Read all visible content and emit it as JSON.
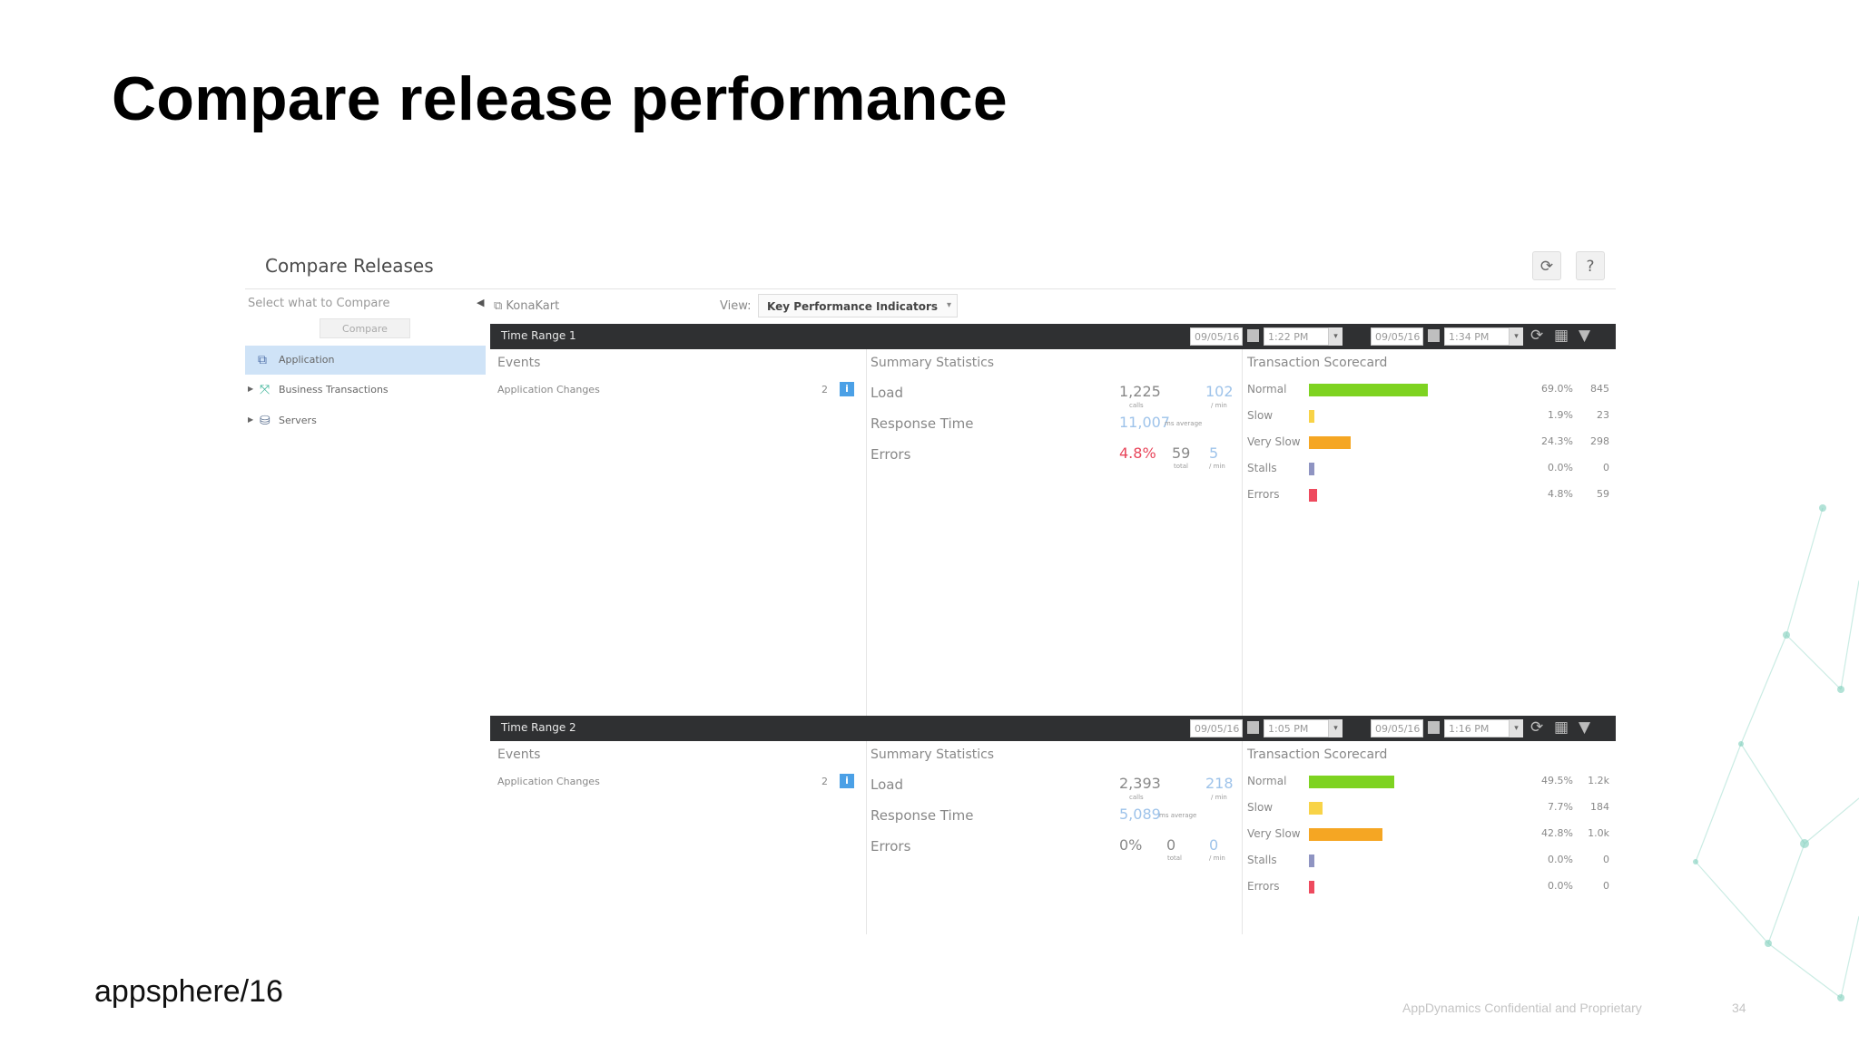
{
  "slide": {
    "title": "Compare release performance",
    "footer_logo": "appsphere/16",
    "confidential": "AppDynamics Confidential and Proprietary",
    "page_number": "34"
  },
  "app": {
    "title": "Compare Releases",
    "refresh_icon": "refresh-icon",
    "help_label": "?"
  },
  "sidebar": {
    "select_label": "Select what to Compare",
    "compare_button": "Compare",
    "items": [
      {
        "label": "Application",
        "icon": "application-icon",
        "selected": true
      },
      {
        "label": "Business Transactions",
        "icon": "business-transaction-icon"
      },
      {
        "label": "Servers",
        "icon": "servers-icon"
      }
    ]
  },
  "toolbar": {
    "app_name": "KonaKart",
    "view_label": "View:",
    "view_value": "Key Performance Indicators"
  },
  "ranges": [
    {
      "label": "Time Range 1",
      "start_date": "09/05/16",
      "start_time": "1:22 PM",
      "end_date": "09/05/16",
      "end_time": "1:34 PM",
      "events_heading": "Events",
      "event_name": "Application Changes",
      "event_count": "2",
      "stats_heading": "Summary Statistics",
      "load_label": "Load",
      "load_calls": "1,225",
      "load_calls_unit": "calls",
      "load_per_min": "102",
      "load_per_min_unit": "/ min",
      "rt_label": "Response Time",
      "rt_value": "11,007",
      "rt_unit": "ms average",
      "err_label": "Errors",
      "err_pct": "4.8%",
      "err_total": "59",
      "err_total_unit": "total",
      "err_per_min": "5",
      "err_per_min_unit": "/ min",
      "scorecard_heading": "Transaction Scorecard",
      "scorecard": [
        {
          "label": "Normal",
          "pct": "69.0%",
          "count": "845",
          "fraction": 0.69,
          "color": "#7ed321"
        },
        {
          "label": "Slow",
          "pct": "1.9%",
          "count": "23",
          "fraction": 0.019,
          "color": "#f8d347"
        },
        {
          "label": "Very Slow",
          "pct": "24.3%",
          "count": "298",
          "fraction": 0.243,
          "color": "#f5a623"
        },
        {
          "label": "Stalls",
          "pct": "0.0%",
          "count": "0",
          "fraction": 0.0,
          "color": "#8f94c2"
        },
        {
          "label": "Errors",
          "pct": "4.8%",
          "count": "59",
          "fraction": 0.048,
          "color": "#ee4a5e"
        }
      ]
    },
    {
      "label": "Time Range 2",
      "start_date": "09/05/16",
      "start_time": "1:05 PM",
      "end_date": "09/05/16",
      "end_time": "1:16 PM",
      "events_heading": "Events",
      "event_name": "Application Changes",
      "event_count": "2",
      "stats_heading": "Summary Statistics",
      "load_label": "Load",
      "load_calls": "2,393",
      "load_calls_unit": "calls",
      "load_per_min": "218",
      "load_per_min_unit": "/ min",
      "rt_label": "Response Time",
      "rt_value": "5,089",
      "rt_unit": "ms average",
      "err_label": "Errors",
      "err_pct": "0%",
      "err_total": "0",
      "err_total_unit": "total",
      "err_per_min": "0",
      "err_per_min_unit": "/ min",
      "scorecard_heading": "Transaction Scorecard",
      "scorecard": [
        {
          "label": "Normal",
          "pct": "49.5%",
          "count": "1.2k",
          "fraction": 0.495,
          "color": "#7ed321"
        },
        {
          "label": "Slow",
          "pct": "7.7%",
          "count": "184",
          "fraction": 0.077,
          "color": "#f8d347"
        },
        {
          "label": "Very Slow",
          "pct": "42.8%",
          "count": "1.0k",
          "fraction": 0.428,
          "color": "#f5a623"
        },
        {
          "label": "Stalls",
          "pct": "0.0%",
          "count": "0",
          "fraction": 0.0,
          "color": "#8f94c2"
        },
        {
          "label": "Errors",
          "pct": "0.0%",
          "count": "0",
          "fraction": 0.0,
          "color": "#ee4a5e"
        }
      ]
    }
  ],
  "colors": {
    "range_bar": "#2f3032",
    "load_value": "#888888",
    "response_time_value": "#9ec3ea",
    "error_pct_value": "#e8455a",
    "selected_item": "#cfe3f7",
    "info_badge": "#4ba0e6"
  }
}
